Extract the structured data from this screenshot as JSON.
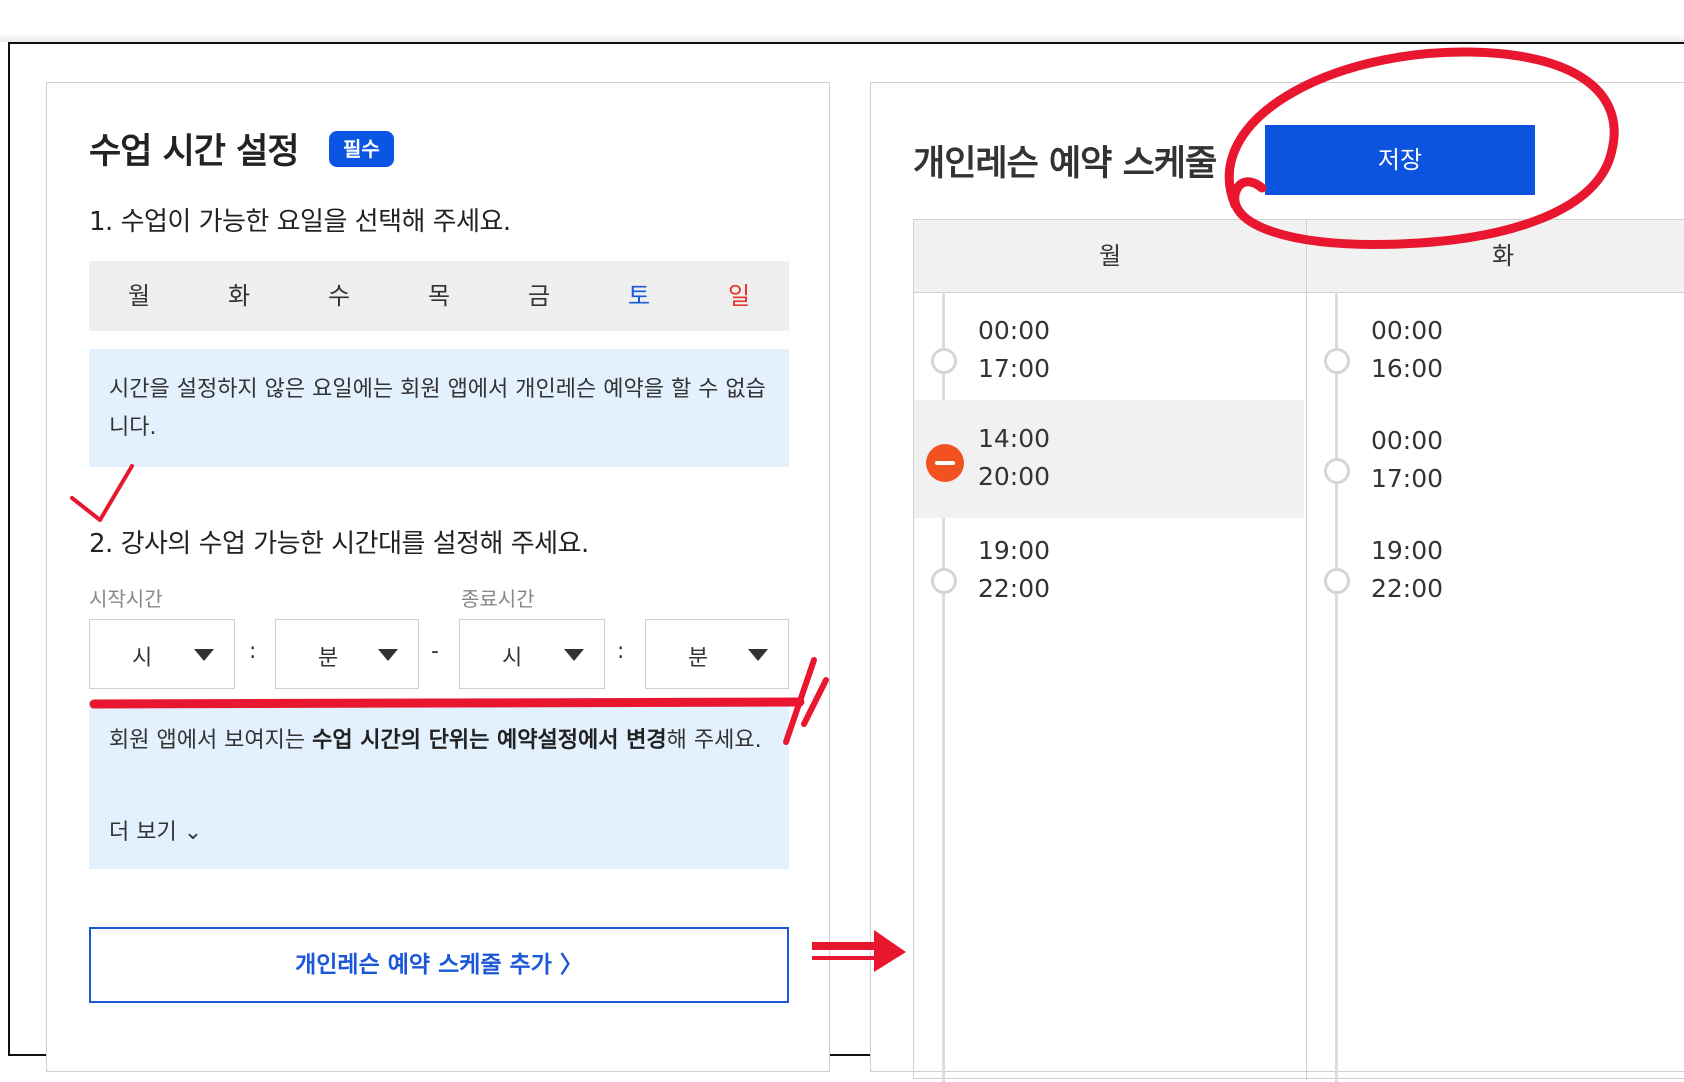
{
  "left": {
    "title": "수업 시간 설정",
    "required_badge": "필수",
    "step1": "1. 수업이 가능한 요일을 선택해 주세요.",
    "days": [
      "월",
      "화",
      "수",
      "목",
      "금",
      "토",
      "일"
    ],
    "info1": "시간을 설정하지 않은 요일에는 회원 앱에서 개인레슨 예약을 할 수 없습니다.",
    "step2": "2. 강사의 수업 가능한 시간대를 설정해 주세요.",
    "start_label": "시작시간",
    "end_label": "종료시간",
    "select_hour": "시",
    "select_minute": "분",
    "sep_colon": ":",
    "sep_dash": "-",
    "info2_a": "회원 앱에서 보여지는 ",
    "info2_b": "수업 시간의 단위는 예약설정에서 변경",
    "info2_c": "해 주세요.",
    "more": "더 보기 ⌄",
    "add_button": "개인레슨 예약 스케줄 추가 〉"
  },
  "right": {
    "title": "개인레슨 예약 스케줄",
    "save_button": "저장",
    "columns": [
      {
        "day": "월",
        "slots": [
          {
            "start": "00:00",
            "end": "17:00",
            "selected": false
          },
          {
            "start": "14:00",
            "end": "20:00",
            "selected": true
          },
          {
            "start": "19:00",
            "end": "22:00",
            "selected": false
          }
        ]
      },
      {
        "day": "화",
        "slots": [
          {
            "start": "00:00",
            "end": "16:00",
            "selected": false
          },
          {
            "start": "00:00",
            "end": "17:00",
            "selected": false
          },
          {
            "start": "19:00",
            "end": "22:00",
            "selected": false
          }
        ]
      }
    ]
  },
  "colors": {
    "accent": "#0c54e0",
    "info_bg": "#e3f0fd",
    "saturday": "#1a5ad8",
    "sunday": "#e6352b",
    "remove": "#f2521f",
    "annotation": "#e8172f"
  }
}
